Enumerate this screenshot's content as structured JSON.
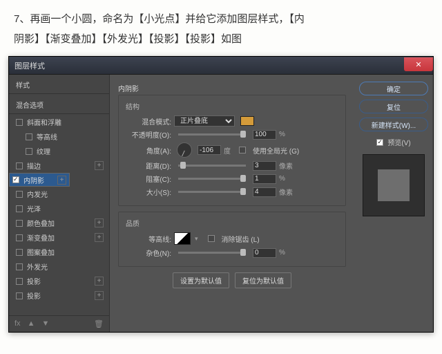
{
  "instruction_line1": "7、再画一个小圆，命名为【小光点】并给它添加图层样式，【内",
  "instruction_line2": "阴影】【渐变叠加】【外发光】【投影】【投影】如图",
  "win_title": "图层样式",
  "sidebar": {
    "styles": "样式",
    "blend": "混合选项",
    "bevel": "斜面和浮雕",
    "contour": "等高线",
    "texture": "纹理",
    "stroke": "描边",
    "inner_shadow": "内阴影",
    "inner_glow": "内发光",
    "satin": "光泽",
    "color_overlay": "颜色叠加",
    "gradient_overlay": "渐变叠加",
    "pattern_overlay": "图案叠加",
    "outer_glow": "外发光",
    "drop_shadow1": "投影",
    "drop_shadow2": "投影",
    "fx": "fx"
  },
  "panel": {
    "title": "内阴影",
    "structure": "结构",
    "blend_mode_label": "混合模式:",
    "blend_mode_value": "正片叠底",
    "opacity_label": "不透明度(O):",
    "opacity_value": "100",
    "pct": "%",
    "angle_label": "角度(A):",
    "angle_value": "-106",
    "deg": "度",
    "global_light": "使用全局光 (G)",
    "distance_label": "距离(D):",
    "distance_value": "3",
    "px": "像素",
    "choke_label": "阻塞(C):",
    "choke_value": "1",
    "size_label": "大小(S):",
    "size_value": "4",
    "quality": "品质",
    "contour_label": "等高线:",
    "antialias": "消除锯齿 (L)",
    "noise_label": "杂色(N):",
    "noise_value": "0",
    "set_default": "设置为默认值",
    "reset_default": "复位为默认值"
  },
  "right": {
    "ok": "确定",
    "reset": "复位",
    "new_style": "新建样式(W)...",
    "preview": "预览(V)"
  }
}
